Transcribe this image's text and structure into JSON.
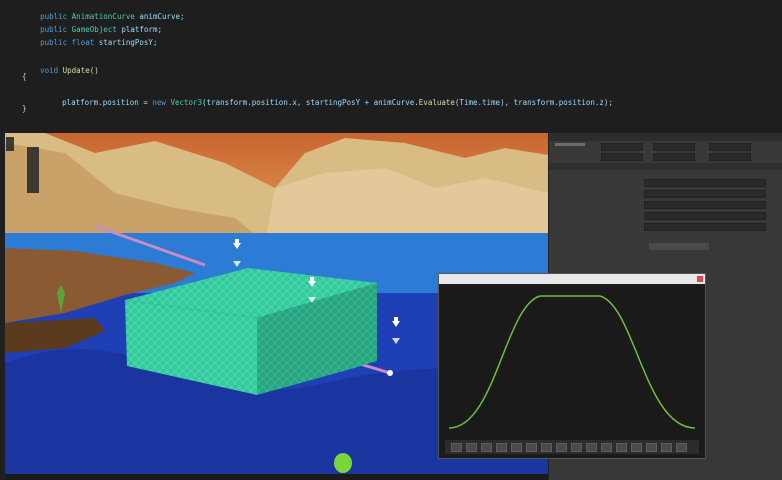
{
  "code": {
    "line1": [
      "public",
      "AnimationCurve",
      "animCurve;"
    ],
    "line2": [
      "public",
      "GameObject",
      "platform;"
    ],
    "line3": [
      "public",
      "float",
      "startingPosY;"
    ],
    "line5": [
      "void",
      "Update()"
    ],
    "line6": "{",
    "line7": [
      "platform.position",
      " = ",
      "new",
      "Vector3",
      "(transform.position.x, startingPosY + animCurve.",
      "Evaluate",
      "(Time.time), transform.position.z);"
    ],
    "line8": "}"
  },
  "curve_editor": {
    "preset_count": 16
  },
  "colors": {
    "code_bg": "#1e1e1e",
    "keyword": "#569cd6",
    "type": "#4ec9b0",
    "curve": "#6fbf3a",
    "platform": "#3fd6a8",
    "water": "#1e3fb5",
    "inspector_bg": "#383838"
  },
  "icons": {
    "play-gizmo": "gizmo-icon",
    "close": "close-icon"
  }
}
